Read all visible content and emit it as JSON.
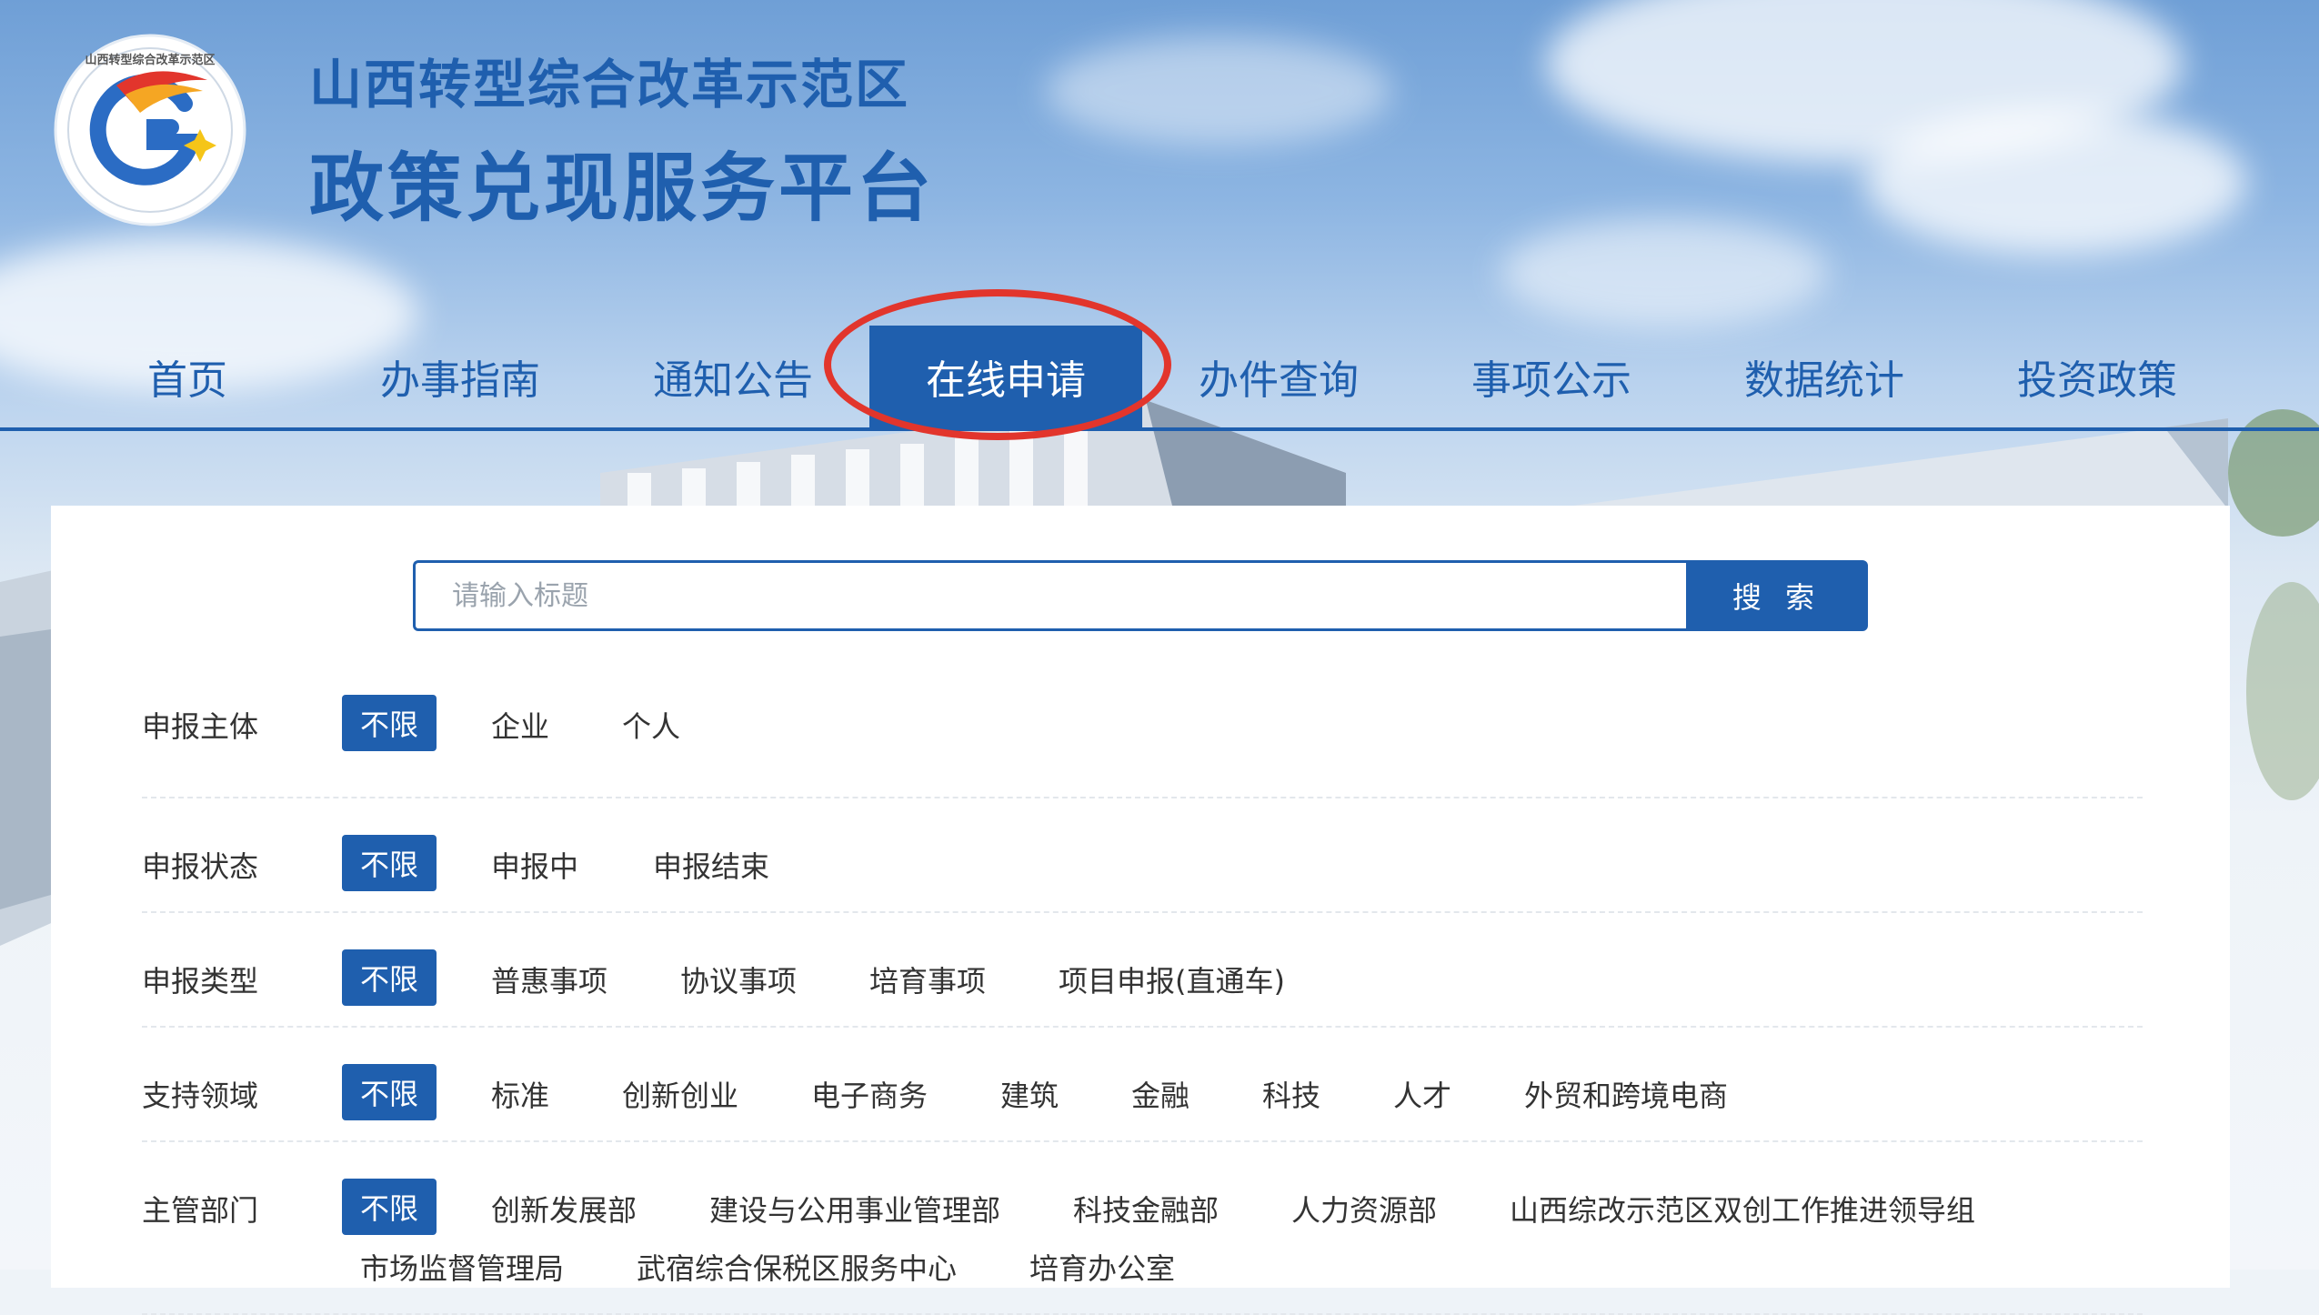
{
  "header": {
    "logo_ring_text": "山西转型综合改革示范区",
    "title_line1": "山西转型综合改革示范区",
    "title_line2": "政策兑现服务平台"
  },
  "nav": {
    "items": [
      {
        "label": "首页"
      },
      {
        "label": "办事指南"
      },
      {
        "label": "通知公告"
      },
      {
        "label": "在线申请",
        "active": true
      },
      {
        "label": "办件查询"
      },
      {
        "label": "事项公示"
      },
      {
        "label": "数据统计"
      },
      {
        "label": "投资政策"
      }
    ]
  },
  "search": {
    "placeholder": "请输入标题",
    "button_label": "搜 索"
  },
  "filters": [
    {
      "label": "申报主体",
      "options": [
        "不限",
        "企业",
        "个人"
      ],
      "selected": "不限"
    },
    {
      "label": "申报状态",
      "options": [
        "不限",
        "申报中",
        "申报结束"
      ],
      "selected": "不限"
    },
    {
      "label": "申报类型",
      "options": [
        "不限",
        "普惠事项",
        "协议事项",
        "培育事项",
        "项目申报(直通车)"
      ],
      "selected": "不限"
    },
    {
      "label": "支持领域",
      "options": [
        "不限",
        "标准",
        "创新创业",
        "电子商务",
        "建筑",
        "金融",
        "科技",
        "人才",
        "外贸和跨境电商"
      ],
      "selected": "不限"
    },
    {
      "label": "主管部门",
      "options": [
        "不限",
        "创新发展部",
        "建设与公用事业管理部",
        "科技金融部",
        "人力资源部",
        "山西综改示范区双创工作推进领导组",
        "市场监督管理局",
        "武宿综合保税区服务中心",
        "培育办公室"
      ],
      "selected": "不限"
    }
  ],
  "colors": {
    "brand": "#1f5fae",
    "highlight": "#e2352c"
  }
}
